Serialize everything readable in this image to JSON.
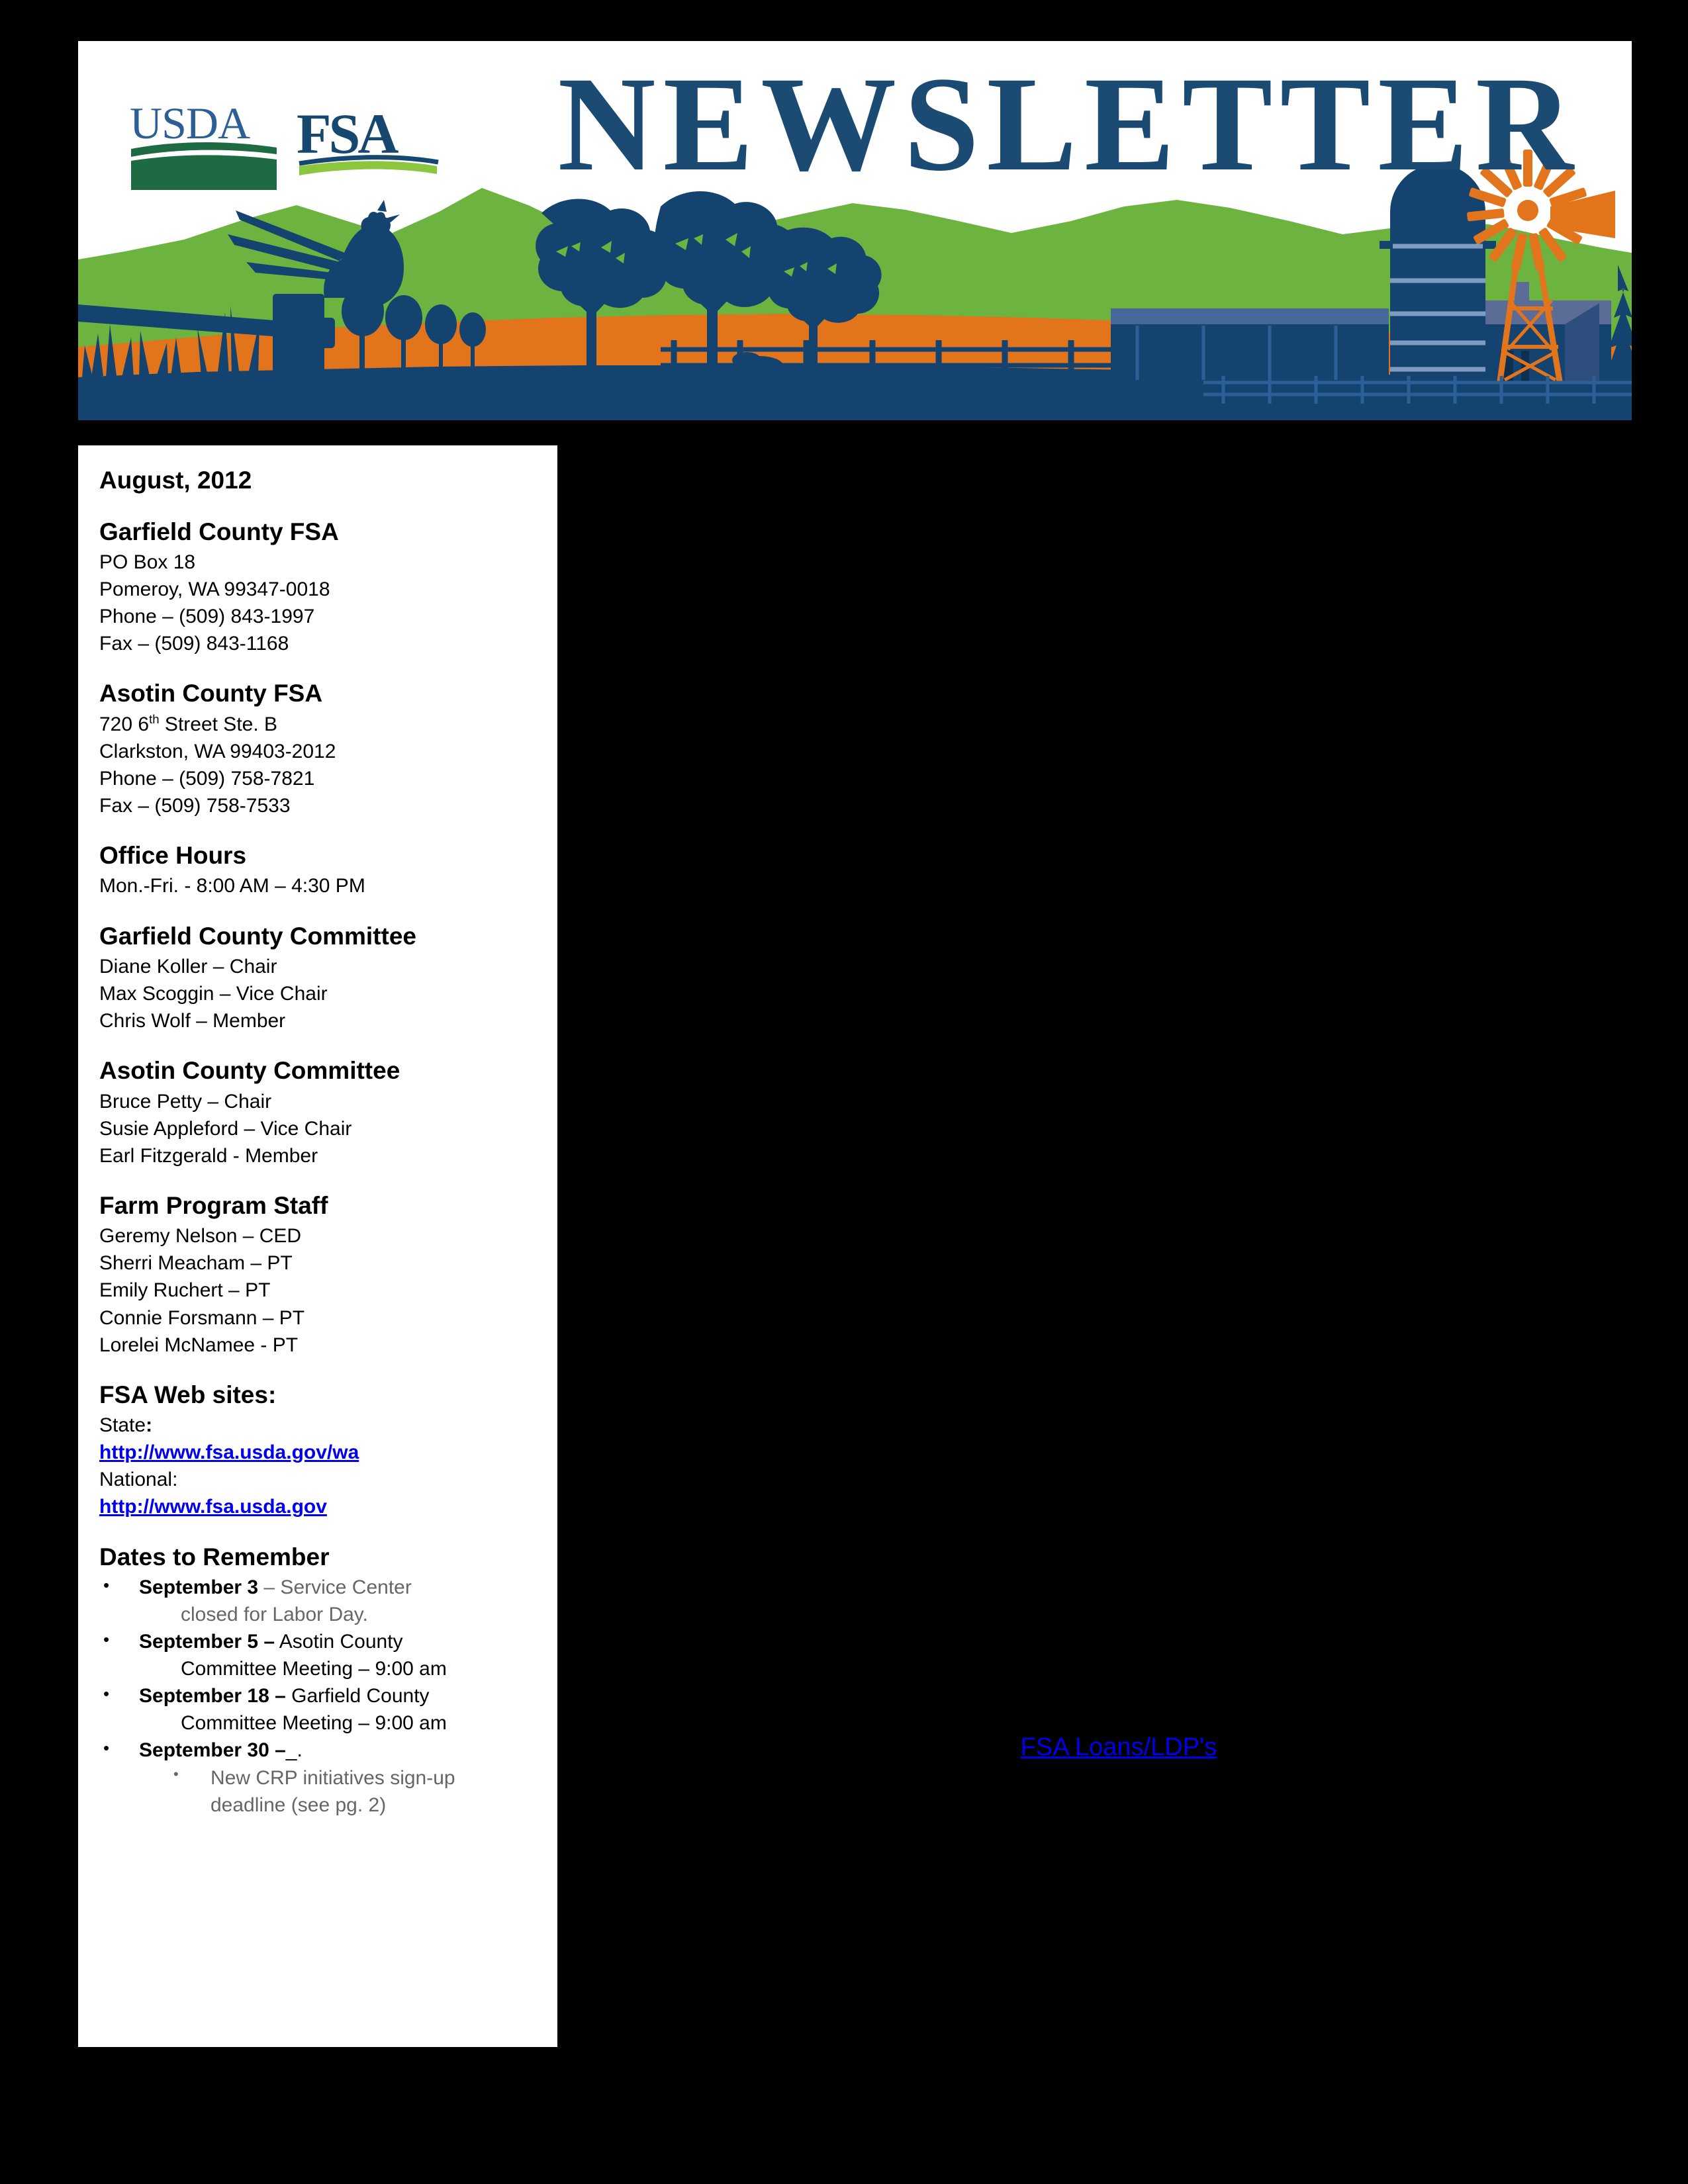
{
  "banner": {
    "title": "NEWSLETTER",
    "logo_usda": "USDA",
    "logo_fsa": "FSA",
    "colors": {
      "navy": "#1b4a72",
      "deep_navy": "#14436f",
      "green_hill": "#6cb33f",
      "green_dark": "#1e6b43",
      "orange": "#e2751c",
      "steel_blue": "#2b5f96",
      "light_green": "#8cc63f"
    },
    "scene_icons": [
      "pheasant-icon",
      "fence-post-icon",
      "tree-icon",
      "silo-icon",
      "barn-icon",
      "windmill-icon",
      "evergreen-icon",
      "grass-icon",
      "hill-icon"
    ]
  },
  "sidebar": {
    "issue_date": "August, 2012",
    "garfield_office": {
      "heading": "Garfield County FSA",
      "lines": [
        "PO Box 18",
        "Pomeroy, WA  99347-0018",
        "Phone – (509) 843-1997",
        "Fax – (509) 843-1168"
      ]
    },
    "asotin_office": {
      "heading": "Asotin County FSA",
      "street_number": "720 6",
      "street_sup": "th",
      "street_rest": " Street Ste. B",
      "lines": [
        "Clarkston, WA  99403-2012",
        "Phone – (509) 758-7821",
        "Fax – (509) 758-7533"
      ]
    },
    "office_hours": {
      "heading": "Office Hours",
      "lines": [
        "Mon.-Fri. - 8:00 AM – 4:30 PM"
      ]
    },
    "garfield_committee": {
      "heading": "Garfield County Committee",
      "lines": [
        "Diane Koller – Chair",
        "Max Scoggin – Vice Chair",
        "Chris Wolf – Member"
      ]
    },
    "asotin_committee": {
      "heading": "Asotin County Committee",
      "lines": [
        "Bruce Petty – Chair",
        "Susie Appleford – Vice Chair",
        "Earl Fitzgerald - Member"
      ]
    },
    "farm_staff": {
      "heading": "Farm Program Staff",
      "lines": [
        "Geremy Nelson – CED",
        "Sherri Meacham – PT",
        "Emily Ruchert – PT",
        "Connie Forsmann – PT",
        "Lorelei McNamee - PT"
      ]
    },
    "web_sites": {
      "heading": "FSA Web sites:",
      "state_label": "State",
      "state_colon": ":",
      "state_url": "http://www.fsa.usda.gov/wa",
      "national_label": "National:",
      "national_url": "http://www.fsa.usda.gov"
    },
    "dates": {
      "heading": "Dates to Remember",
      "items": [
        {
          "label": "September 3",
          "rest": " – Service Center",
          "cont": "closed for Labor Day.",
          "grey": true
        },
        {
          "label": "September 5 –",
          "rest": " Asotin County",
          "cont": "Committee Meeting – 9:00 am",
          "grey": false
        },
        {
          "label": "September 18 –",
          "rest": " Garfield County",
          "cont": "Committee Meeting – 9:00 am",
          "grey": false
        },
        {
          "label": "September 30 –",
          "rest": "_.",
          "cont": "",
          "grey": false,
          "sub": [
            {
              "text": "New CRP initiatives sign-up",
              "cont": "deadline (see pg. 2)"
            }
          ]
        }
      ]
    }
  },
  "main": {
    "article_heading": "FSA Loans/LDP's",
    "link_color": "#0000ee"
  }
}
